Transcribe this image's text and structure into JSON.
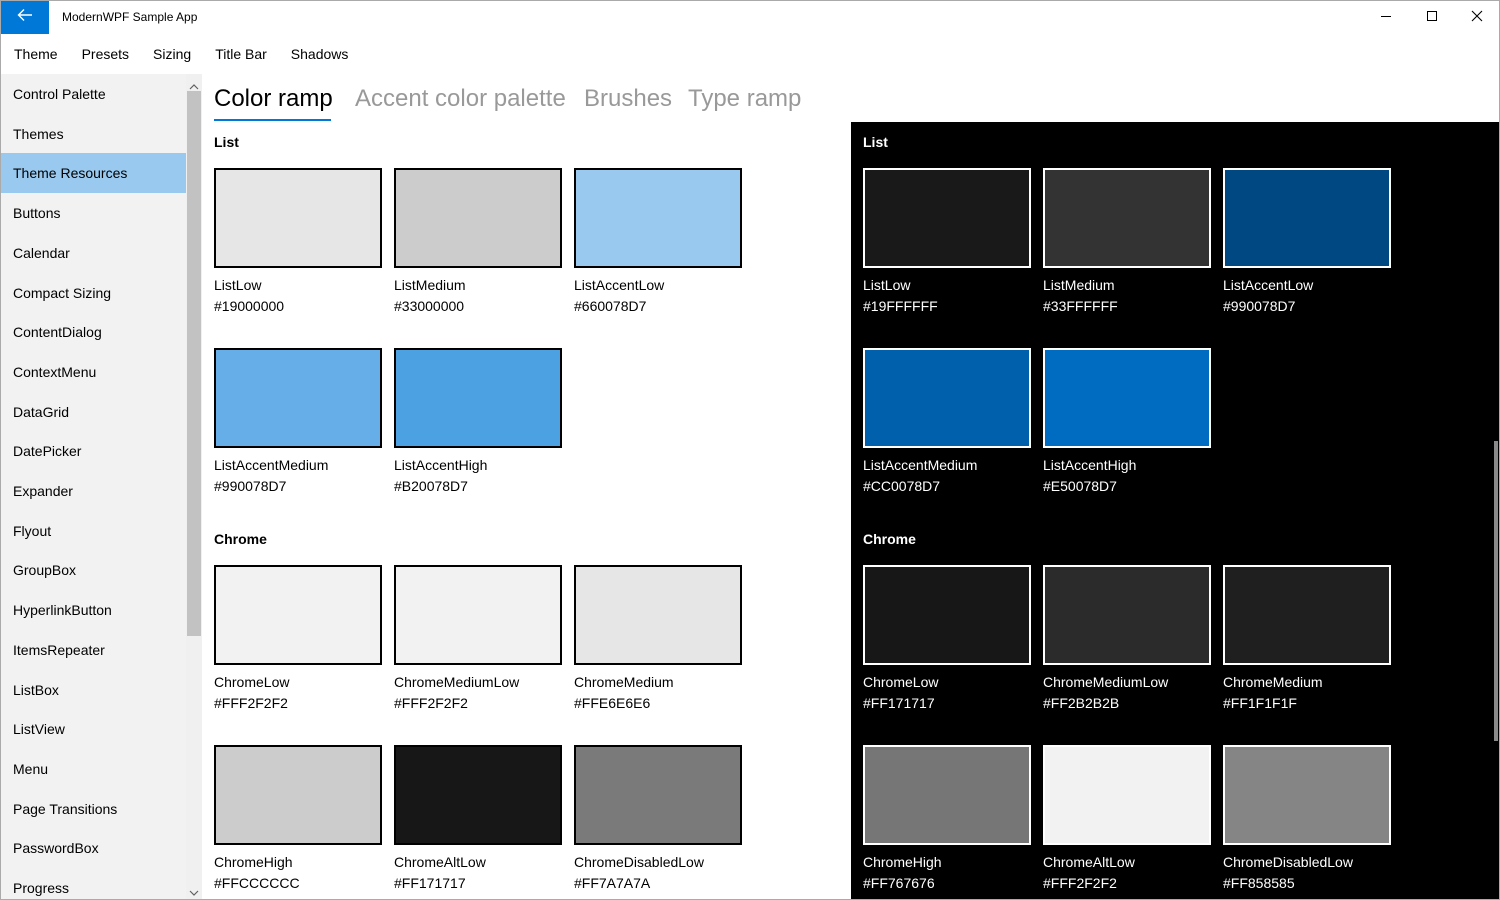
{
  "app": {
    "title": "ModernWPF Sample App"
  },
  "menu": [
    "Theme",
    "Presets",
    "Sizing",
    "Title Bar",
    "Shadows"
  ],
  "sidebar": {
    "items": [
      {
        "label": "Control Palette",
        "selected": false
      },
      {
        "label": "Themes",
        "selected": false
      },
      {
        "label": "Theme Resources",
        "selected": true
      },
      {
        "label": "Buttons",
        "selected": false
      },
      {
        "label": "Calendar",
        "selected": false
      },
      {
        "label": "Compact Sizing",
        "selected": false
      },
      {
        "label": "ContentDialog",
        "selected": false
      },
      {
        "label": "ContextMenu",
        "selected": false
      },
      {
        "label": "DataGrid",
        "selected": false
      },
      {
        "label": "DatePicker",
        "selected": false
      },
      {
        "label": "Expander",
        "selected": false
      },
      {
        "label": "Flyout",
        "selected": false
      },
      {
        "label": "GroupBox",
        "selected": false
      },
      {
        "label": "HyperlinkButton",
        "selected": false
      },
      {
        "label": "ItemsRepeater",
        "selected": false
      },
      {
        "label": "ListBox",
        "selected": false
      },
      {
        "label": "ListView",
        "selected": false
      },
      {
        "label": "Menu",
        "selected": false
      },
      {
        "label": "Page Transitions",
        "selected": false
      },
      {
        "label": "PasswordBox",
        "selected": false
      },
      {
        "label": "Progress",
        "selected": false
      }
    ]
  },
  "tabs": [
    {
      "label": "Color ramp",
      "active": true
    },
    {
      "label": "Accent color palette",
      "active": false
    },
    {
      "label": "Brushes",
      "active": false
    },
    {
      "label": "Type ramp",
      "active": false
    }
  ],
  "light": {
    "sections": [
      {
        "title": "List",
        "swatches": [
          {
            "name": "ListLow",
            "code": "#19000000",
            "fill": "#e6e6e6"
          },
          {
            "name": "ListMedium",
            "code": "#33000000",
            "fill": "#cccccc"
          },
          {
            "name": "ListAccentLow",
            "code": "#660078D7",
            "fill": "#99c9ef"
          },
          {
            "name": "ListAccentMedium",
            "code": "#990078D7",
            "fill": "#66aee7"
          },
          {
            "name": "ListAccentHigh",
            "code": "#B20078D7",
            "fill": "#4ca1e3"
          }
        ]
      },
      {
        "title": "Chrome",
        "swatches": [
          {
            "name": "ChromeLow",
            "code": "#FFF2F2F2",
            "fill": "#f2f2f2"
          },
          {
            "name": "ChromeMediumLow",
            "code": "#FFF2F2F2",
            "fill": "#f2f2f2"
          },
          {
            "name": "ChromeMedium",
            "code": "#FFE6E6E6",
            "fill": "#e6e6e6"
          },
          {
            "name": "ChromeHigh",
            "code": "#FFCCCCCC",
            "fill": "#cccccc"
          },
          {
            "name": "ChromeAltLow",
            "code": "#FF171717",
            "fill": "#171717"
          },
          {
            "name": "ChromeDisabledLow",
            "code": "#FF7A7A7A",
            "fill": "#7a7a7a"
          }
        ]
      }
    ]
  },
  "dark": {
    "sections": [
      {
        "title": "List",
        "swatches": [
          {
            "name": "ListLow",
            "code": "#19FFFFFF",
            "fill": "#191919"
          },
          {
            "name": "ListMedium",
            "code": "#33FFFFFF",
            "fill": "#333333"
          },
          {
            "name": "ListAccentLow",
            "code": "#990078D7",
            "fill": "#004881"
          },
          {
            "name": "ListAccentMedium",
            "code": "#CC0078D7",
            "fill": "#0060ac"
          },
          {
            "name": "ListAccentHigh",
            "code": "#E50078D7",
            "fill": "#006cc1"
          }
        ]
      },
      {
        "title": "Chrome",
        "swatches": [
          {
            "name": "ChromeLow",
            "code": "#FF171717",
            "fill": "#171717"
          },
          {
            "name": "ChromeMediumLow",
            "code": "#FF2B2B2B",
            "fill": "#2b2b2b"
          },
          {
            "name": "ChromeMedium",
            "code": "#FF1F1F1F",
            "fill": "#1f1f1f"
          },
          {
            "name": "ChromeHigh",
            "code": "#FF767676",
            "fill": "#767676"
          },
          {
            "name": "ChromeAltLow",
            "code": "#FFF2F2F2",
            "fill": "#f2f2f2"
          },
          {
            "name": "ChromeDisabledLow",
            "code": "#FF858585",
            "fill": "#858585"
          }
        ]
      }
    ]
  },
  "colors": {
    "accent": "#0078d7",
    "selected_nav": "#99c9ef",
    "sidebar_bg": "#f2f2f2"
  }
}
